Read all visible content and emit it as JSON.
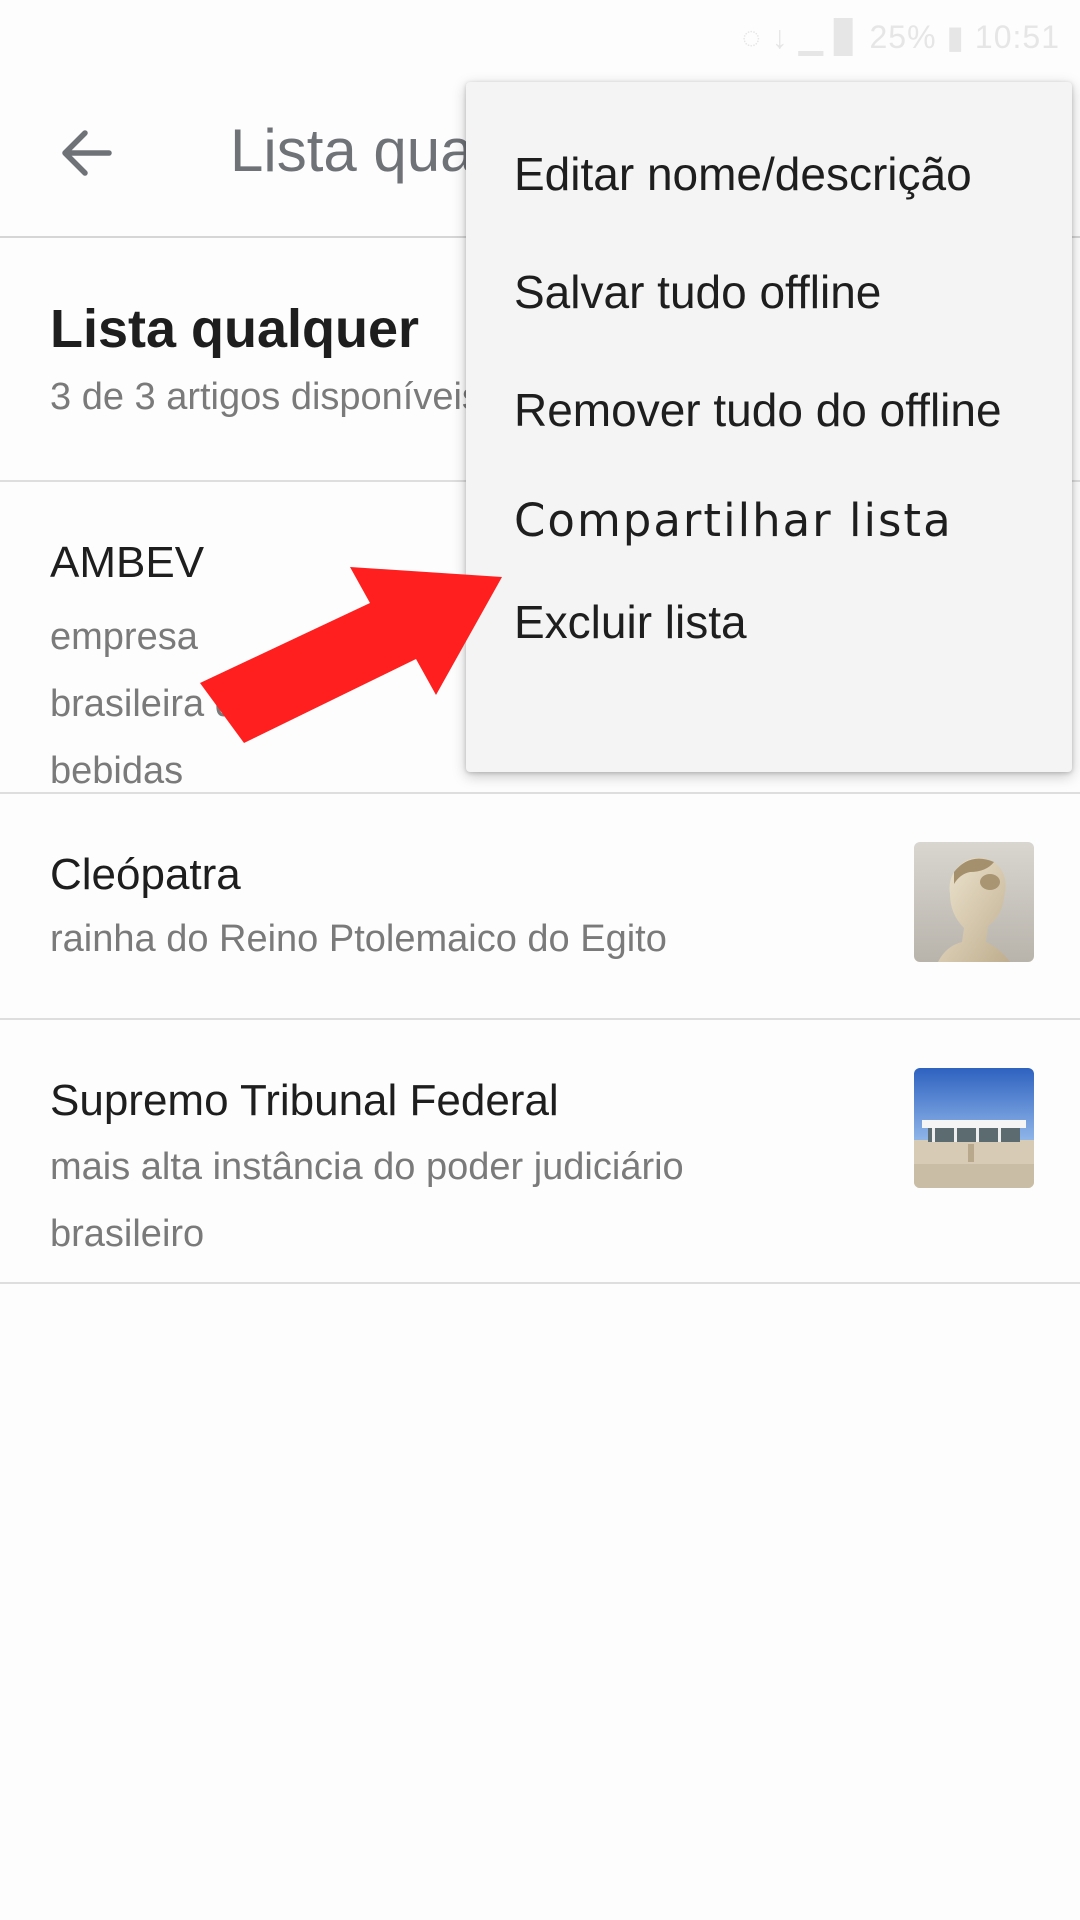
{
  "status_bar": {
    "text": "◌ ↓ ▁ ▊ 25% ▮ 10:51"
  },
  "app_bar": {
    "back_icon": "arrow-left-icon",
    "title": "Lista qualquer"
  },
  "list": {
    "title": "Lista qualquer",
    "subtitle": "3 de 3 artigos disponíveis offline"
  },
  "articles": [
    {
      "title": "AMBEV",
      "description": "empresa brasileira de bebidas"
    },
    {
      "title": "Cleópatra",
      "description": "rainha do Reino Ptolemaico do Egito",
      "thumbnail": "bust-sculpture"
    },
    {
      "title": "Supremo Tribunal Federal",
      "description": "mais alta instância do poder judiciário brasileiro",
      "thumbnail": "building-photo"
    }
  ],
  "menu": {
    "items": [
      "Editar nome/descrição",
      "Salvar tudo offline",
      "Remover tudo do offline",
      "Compartilhar lista",
      "Excluir lista"
    ]
  },
  "colors": {
    "annotation_arrow": "#ff1f1f",
    "menu_background": "#f4f4f4",
    "title_gray": "#6f7378",
    "secondary_text": "#7a7a7a"
  }
}
